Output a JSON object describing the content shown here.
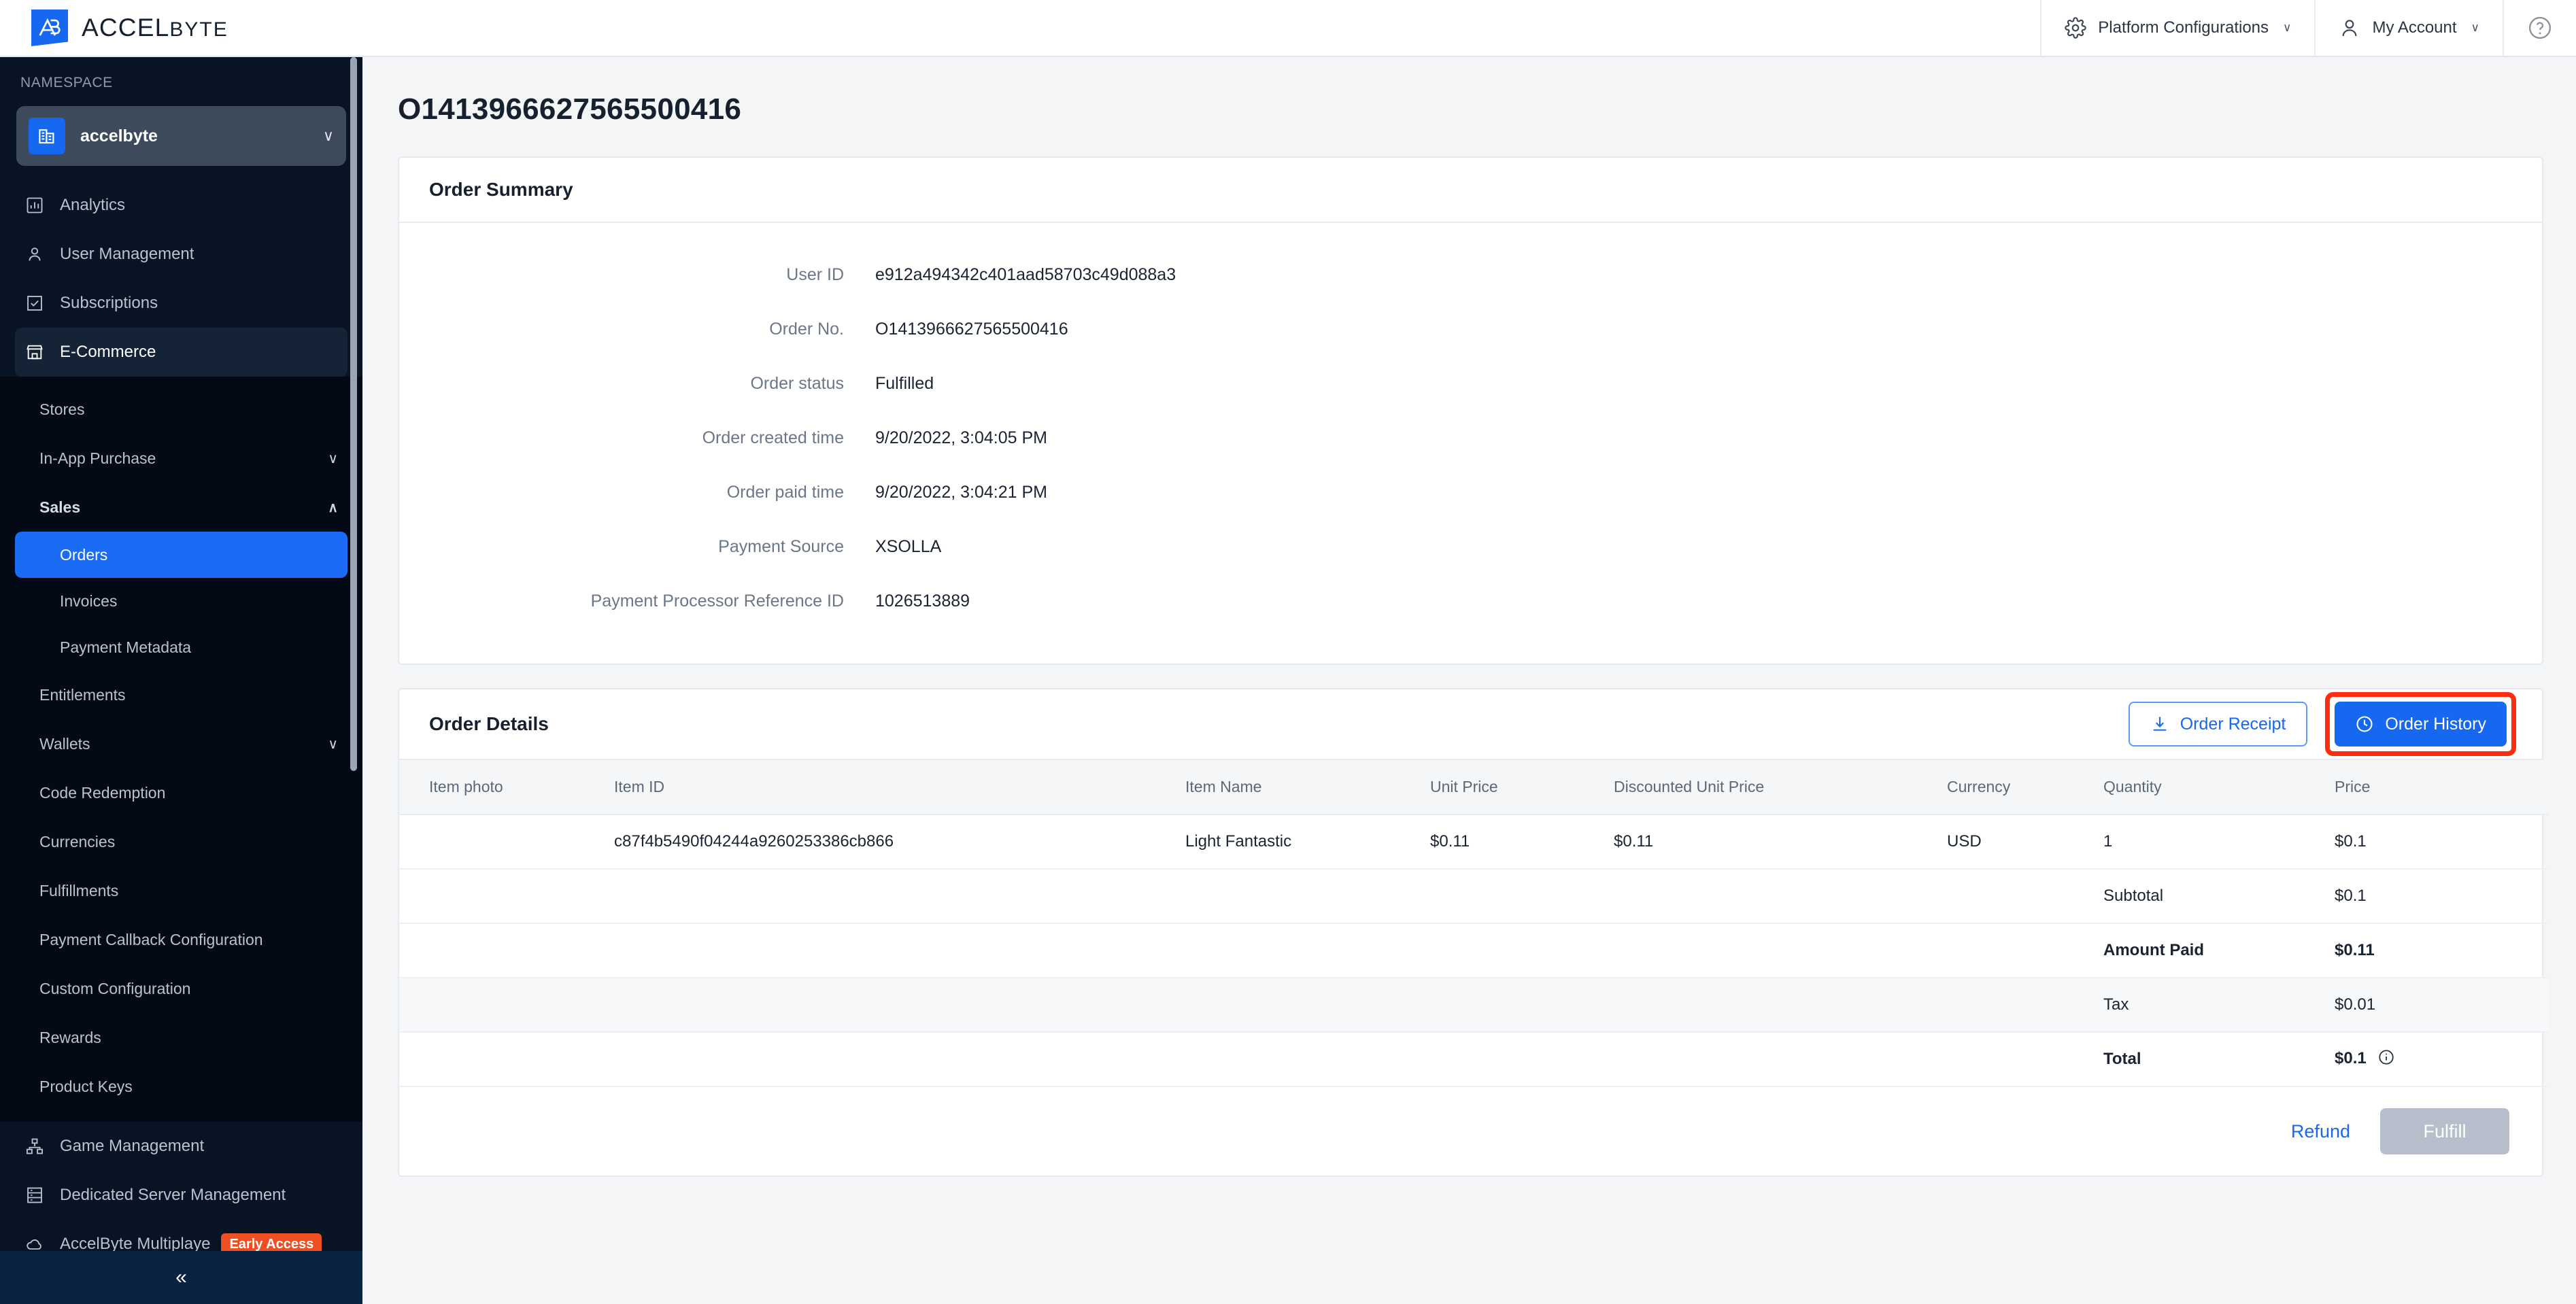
{
  "brand": {
    "name_main": "ACCEL",
    "name_sub": "BYTE",
    "accent_blue": "#1668f0",
    "sidebar_bg": "#081324",
    "highlight_red": "#ff2d10",
    "green": "#11763b"
  },
  "topbar": {
    "platform_configurations": "Platform Configurations",
    "my_account": "My Account",
    "chevron": "∨",
    "help_icon": "question-circle-icon"
  },
  "sidebar": {
    "namespace_label": "NAMESPACE",
    "namespace_value": "accelbyte",
    "namespace_chevron": "∨",
    "collapse_glyph": "«",
    "items": [
      {
        "label": "Analytics",
        "icon": "chart-bar-icon"
      },
      {
        "label": "User Management",
        "icon": "user-icon"
      },
      {
        "label": "Subscriptions",
        "icon": "checkbox-icon"
      },
      {
        "label": "E-Commerce",
        "icon": "store-icon",
        "active": true
      }
    ],
    "submenu": [
      {
        "label": "Stores",
        "type": "sub"
      },
      {
        "label": "In-App Purchase",
        "type": "sub",
        "caret": "∨"
      },
      {
        "label": "Sales",
        "type": "sub",
        "bold": true,
        "caret": "∧"
      },
      {
        "label": "Orders",
        "type": "subsub",
        "selected": true
      },
      {
        "label": "Invoices",
        "type": "subsub"
      },
      {
        "label": "Payment Metadata",
        "type": "subsub"
      },
      {
        "label": "Entitlements",
        "type": "sub"
      },
      {
        "label": "Wallets",
        "type": "sub",
        "caret": "∨"
      },
      {
        "label": "Code Redemption",
        "type": "sub"
      },
      {
        "label": "Currencies",
        "type": "sub"
      },
      {
        "label": "Fulfillments",
        "type": "sub"
      },
      {
        "label": "Payment Callback Configuration",
        "type": "sub"
      },
      {
        "label": "Custom Configuration",
        "type": "sub"
      },
      {
        "label": "Rewards",
        "type": "sub"
      },
      {
        "label": "Product Keys",
        "type": "sub"
      }
    ],
    "items_bottom": [
      {
        "label": "Game Management",
        "icon": "sitemap-icon"
      },
      {
        "label": "Dedicated Server Management",
        "icon": "server-icon"
      },
      {
        "label": "AccelByte Multiplaye",
        "icon": "cloud-icon",
        "badge": "Early Access"
      }
    ]
  },
  "page": {
    "title": "O1413966627565500416"
  },
  "order_summary": {
    "title": "Order Summary",
    "fields": [
      {
        "label": "User ID",
        "value": "e912a494342c401aad58703c49d088a3"
      },
      {
        "label": "Order No.",
        "value": "O1413966627565500416"
      },
      {
        "label": "Order status",
        "value": "Fulfilled"
      },
      {
        "label": "Order created time",
        "value": "9/20/2022, 3:04:05 PM"
      },
      {
        "label": "Order paid time",
        "value": "9/20/2022, 3:04:21 PM"
      },
      {
        "label": "Payment Source",
        "value": "XSOLLA"
      },
      {
        "label": "Payment Processor Reference ID",
        "value": "1026513889"
      }
    ]
  },
  "order_details": {
    "title": "Order Details",
    "order_receipt_label": "Order Receipt",
    "order_receipt_icon": "download-icon",
    "order_history_label": "Order History",
    "order_history_icon": "clock-icon",
    "columns": [
      "Item photo",
      "Item ID",
      "Item Name",
      "Unit Price",
      "Discounted Unit Price",
      "Currency",
      "Quantity",
      "Price"
    ],
    "rows": [
      {
        "item_photo": "",
        "item_id": "c87f4b5490f04244a9260253386cb866",
        "item_name": "Light Fantastic",
        "unit_price": "$0.11",
        "discounted_unit_price": "$0.11",
        "currency": "USD",
        "quantity": "1",
        "price": "$0.1"
      }
    ],
    "totals": [
      {
        "label": "Subtotal",
        "value": "$0.1",
        "style": "normal",
        "striped": false
      },
      {
        "label": "Amount Paid",
        "value": "$0.11",
        "style": "green",
        "striped": false
      },
      {
        "label": "Tax",
        "value": "$0.01",
        "style": "normal",
        "striped": true
      },
      {
        "label": "Total",
        "value": "$0.1",
        "style": "bold",
        "striped": false,
        "info_icon": "info-circle-icon"
      }
    ],
    "refund_label": "Refund",
    "fulfill_label": "Fulfill"
  }
}
